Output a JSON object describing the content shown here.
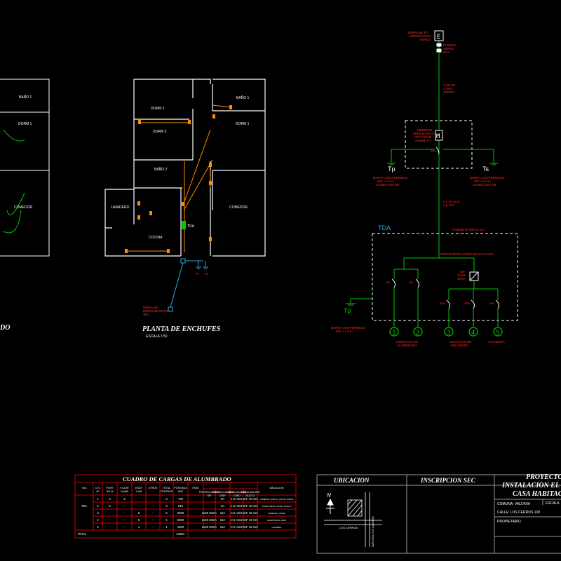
{
  "colors": {
    "background": "#000000",
    "walls": "#ffffff",
    "circuit_green": "#00c800",
    "label_red": "#ff2a2a",
    "feeder_cyan": "#2aa8d8",
    "outlet_orange": "#ff8c00",
    "frame_gray": "#9a9a9a",
    "table_red": "#ff0000"
  },
  "left_plan": {
    "rooms": [
      "BAÑO 1",
      "DORM 1",
      "COMEDOR"
    ],
    "title_fragment": "DO"
  },
  "socket_plan": {
    "title": "PLANTA DE ENCHUFES",
    "scale": "ESCALA 1:50",
    "rooms": [
      "BAÑO 1",
      "DORM 2",
      "DORM 3",
      "DORM 1",
      "BAÑO 2",
      "LAVADERO",
      "COMEDOR",
      "COCINA"
    ],
    "tda_label": "TDA",
    "ground_labels": [
      "TP",
      "TS"
    ],
    "feeder_label_lines": [
      "EMPALME",
      "EMPALME-ENTR",
      "SEC ..."
    ]
  },
  "single_line": {
    "empalme_label": [
      "EMPALME BT",
      "MONOFASICO",
      "AEREO"
    ],
    "fuse_label": [
      "FUSIBLE",
      "AEREO",
      "63 A"
    ],
    "feeder_label": [
      "3 HILOS",
      "4 mm2",
      "AEREO"
    ],
    "meter_label": [
      "MEDIDOR",
      "MONOFASICO",
      "TIPO CHILE",
      "SOBRE PT"
    ],
    "meter_breaker": "25A",
    "tp_label": "Tp",
    "ts_label": "Ts",
    "tp_bar_label": [
      "BARRA COOPERWELD",
      "5/8\" x 1.5 m",
      "CONECTOR 5/8\""
    ],
    "ts_bar_label": [
      "BARRA COOPERWELD",
      "5/8\" x 1.5 m",
      "CONECTOR 5/8\""
    ],
    "tda_feeder_label": [
      "2 x 10 mm2",
      "e.p. 3/4\""
    ],
    "tda_label": "TDA",
    "cabinet_label": "GABINETE METALICO",
    "rail_label": "REPARTIDOR LEGRAND 1P+N 100A ..",
    "dif_label": [
      "DIF",
      "2x25A",
      "30mA"
    ],
    "breakers_light": [
      "6A",
      "6A"
    ],
    "breakers_outlet": [
      "15A",
      "15A",
      "15A"
    ],
    "tp2_label": "Tp",
    "tp2_bar_label": [
      "BARRA COOPERWELD",
      "5/8\" x 1.5 m"
    ],
    "circuits": [
      "1",
      "2",
      "3",
      "4",
      "5"
    ],
    "circuit_group_labels": [
      [
        "CIRCUITOS DE",
        "ALUMBRADO"
      ],
      [
        "CIRCUITOS DE",
        "ENCHUFES"
      ],
      [
        "LAVADORA"
      ]
    ]
  },
  "load_table": {
    "title": "CUADRO DE CARGAS DE ALUMBRADO",
    "headers": [
      "TDA",
      "CTO Nº",
      "PORT 100 W",
      "FLUOR 2x40W",
      "ENCH 1 KW",
      "OTROS",
      "TOTAL CENTROS",
      "POTENCIA WAT",
      "FASE",
      "PROTECCIONES DIF",
      "PROTECCIONES DISY",
      "CANALIZACION COND",
      "CANALIZACION DUCTO",
      "UBICACION"
    ],
    "rows": [
      [
        "",
        "1",
        "6",
        "2",
        "-",
        "-",
        "8",
        "740",
        "",
        "",
        "6A",
        "1,5 mm2",
        "3/4\" 16 mm",
        "COMEDOR, PASILLO, COCINA, BAÑOS"
      ],
      [
        "TDA",
        "2",
        "6",
        "-",
        "-",
        "-",
        "6",
        "510",
        "",
        "",
        "6A",
        "1,5 mm2",
        "3/4\" 16 mm",
        "DORMITORIOS, COCINA, PASILLO"
      ],
      [
        "",
        "3",
        "-",
        "-",
        "5",
        "-",
        "5",
        "5000",
        "",
        "2x25 30mA",
        "15A",
        "2,5 mm2",
        "3/4\" 16 mm",
        "COMEDOR, COCINA"
      ],
      [
        "",
        "4",
        "-",
        "-",
        "5",
        "-",
        "5",
        "5000",
        "",
        "2x25 30mA",
        "15A",
        "2,5 mm2",
        "3/4\" 16 mm",
        "DORMITORIOS, BAÑO"
      ],
      [
        "",
        "5",
        "-",
        "-",
        "1",
        "-",
        "1",
        "1000",
        "",
        "2x25 30mA",
        "15A",
        "2,5 mm2",
        "3/4\" 16 mm",
        "LAVADERO"
      ]
    ],
    "total_label": "TOTAL",
    "total_value": "12250"
  },
  "title_block": {
    "ubicacion": "UBICACION",
    "inscripcion": "INSCRIPCION SEC",
    "project_lines": [
      "PROYECTO",
      "INSTALACION EL",
      "CASA HABITAC"
    ],
    "comuna": "COMUNA: VALDIVIA",
    "calle": "CALLE: LOS CERROS 100",
    "propietario": "PROPIETARIO",
    "escala": "ESCALA",
    "north": "N",
    "street_h": "LOS CERROS",
    "street_v": "AVENIDA LOS ALAMOS"
  }
}
